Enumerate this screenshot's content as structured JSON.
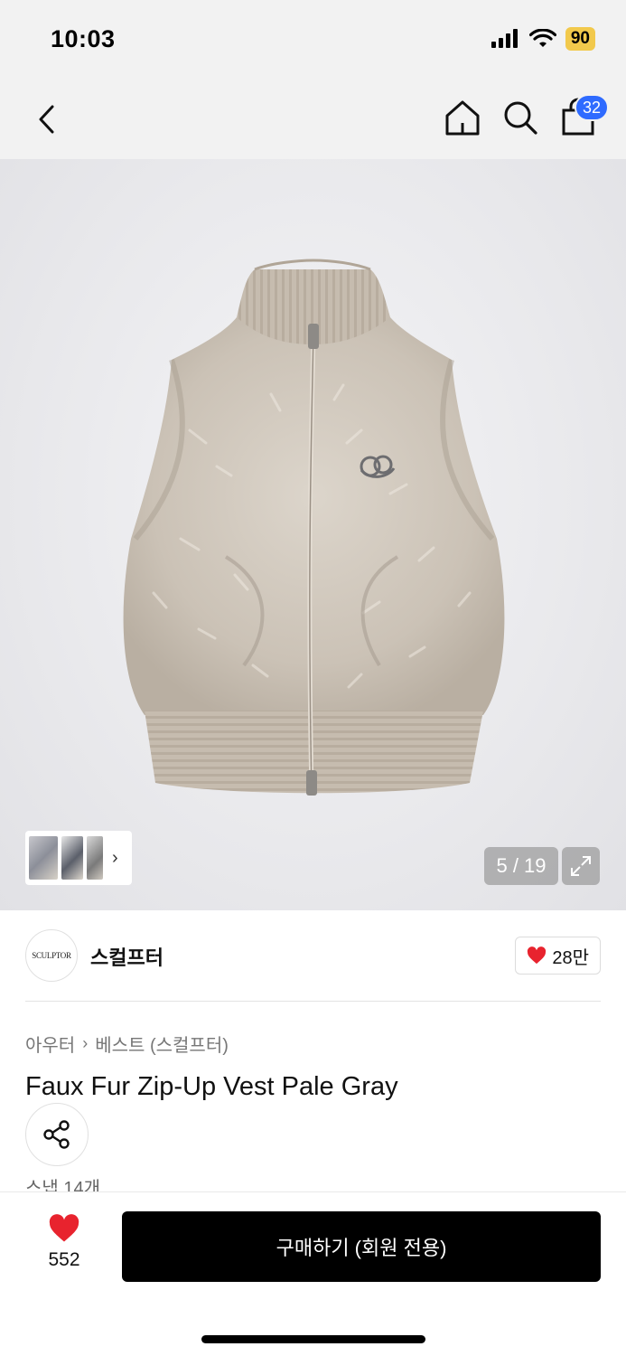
{
  "status_bar": {
    "time": "10:03",
    "battery": "90",
    "icons": [
      "cellular-signal-icon",
      "wifi-icon"
    ]
  },
  "nav": {
    "icons": [
      "back-chevron-icon",
      "home-icon",
      "search-icon",
      "shopping-bag-icon"
    ],
    "cart_count": "32"
  },
  "gallery": {
    "page_indicator": "5 / 19",
    "icons": [
      "chevron-right-icon",
      "expand-icon"
    ]
  },
  "brand": {
    "logo_text": "SCULPTOR",
    "name": "스컬프터",
    "like_count": "28만",
    "like_icon": "heart-icon",
    "like_color": "#e8232e"
  },
  "breadcrumb": {
    "category": "아우터",
    "subcategory": "베스트 (스컬프터)"
  },
  "product": {
    "title": "Faux Fur Zip-Up Vest Pale Gray",
    "snap_count": "스냅 14개",
    "share_icon": "share-icon"
  },
  "bottom_bar": {
    "like_count": "552",
    "buy_label": "구매하기 (회원 전용)",
    "like_color": "#e8232e"
  }
}
